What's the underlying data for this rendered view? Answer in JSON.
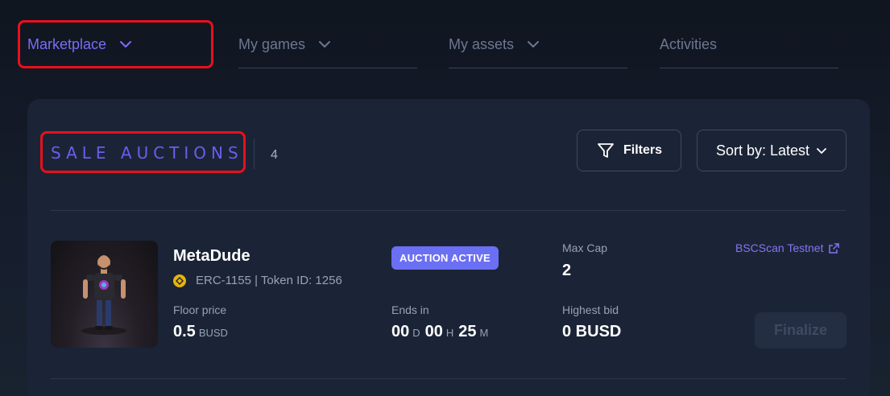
{
  "nav": {
    "items": [
      {
        "label": "Marketplace",
        "active": true
      },
      {
        "label": "My games",
        "active": false
      },
      {
        "label": "My assets",
        "active": false
      },
      {
        "label": "Activities",
        "active": false
      }
    ]
  },
  "section": {
    "title": "SALE AUCTIONS",
    "count": "4"
  },
  "toolbar": {
    "filters_label": "Filters",
    "sort_label": "Sort by: Latest"
  },
  "auction": {
    "name": "MetaDude",
    "token_info": "ERC-1155 | Token ID: 1256",
    "status_badge": "AUCTION ACTIVE",
    "floor_price_label": "Floor price",
    "floor_price_value": "0.5",
    "floor_price_unit": "BUSD",
    "ends_in_label": "Ends in",
    "ends_days": "00",
    "ends_days_unit": "D",
    "ends_hours": "00",
    "ends_hours_unit": "H",
    "ends_minutes": "25",
    "ends_minutes_unit": "M",
    "max_cap_label": "Max Cap",
    "max_cap_value": "2",
    "highest_bid_label": "Highest bid",
    "highest_bid_value": "0 BUSD",
    "explorer_link": "BSCScan Testnet",
    "finalize_label": "Finalize"
  },
  "colors": {
    "accent": "#7b6cf6",
    "badge": "#6b6ff3",
    "highlight_box": "#e8101d",
    "token_coin": "#e7b40b"
  },
  "icons": [
    "chevron-down-icon",
    "filter-icon",
    "external-link-icon",
    "bnb-coin-icon"
  ]
}
